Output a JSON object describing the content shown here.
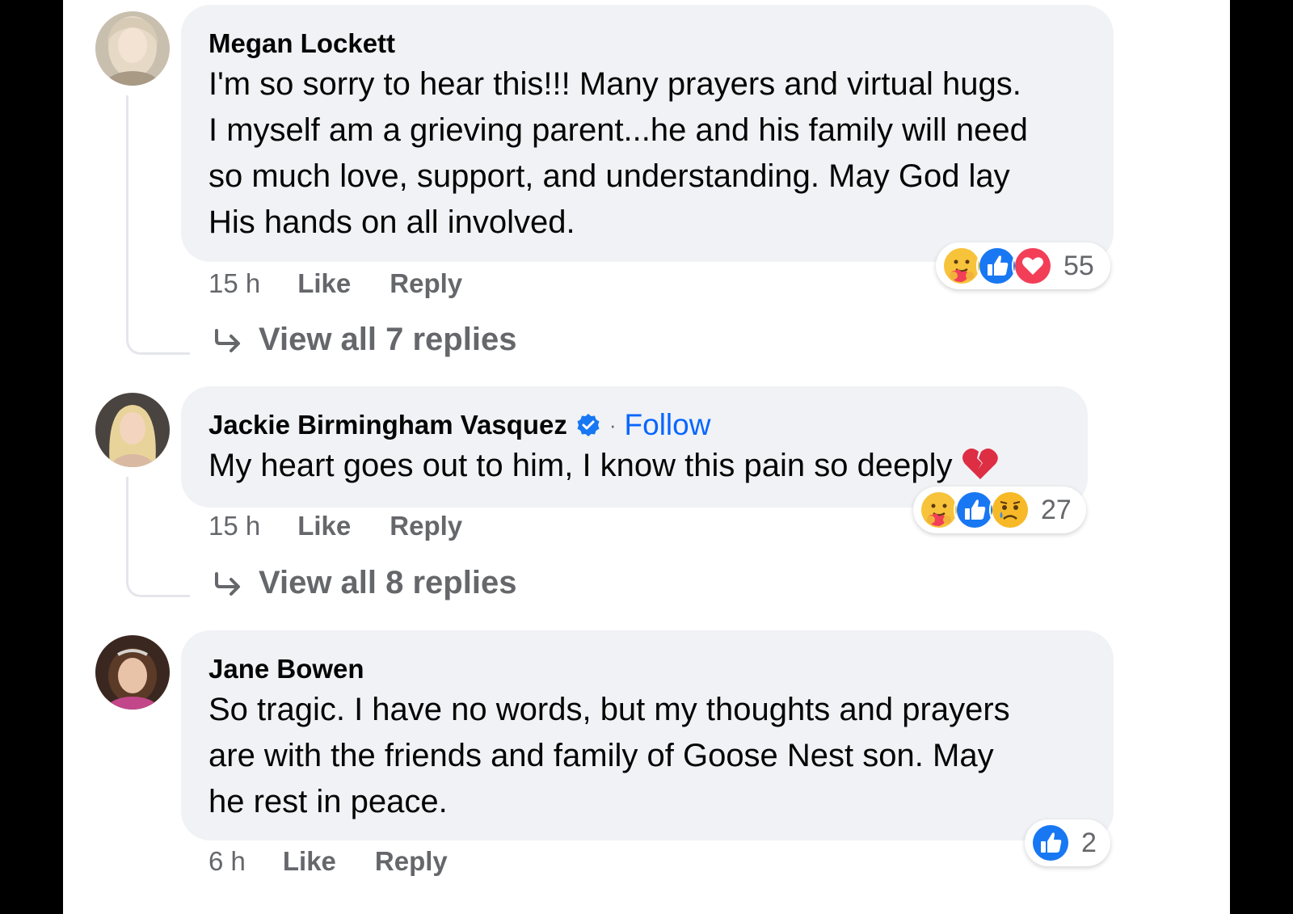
{
  "colors": {
    "bubble_bg": "#f0f2f5",
    "link_blue": "#0866ff",
    "muted_text": "#65676b",
    "like_blue": "#1877f2",
    "love_red": "#f33e58"
  },
  "comments": [
    {
      "author": "Megan Lockett",
      "verified": false,
      "text": "I'm so sorry to hear this!!! Many prayers and virtual hugs.\nI myself am a grieving parent...he and his family will need\nso much love, support, and understanding. May God lay\nHis hands on all involved.",
      "time": "15 h",
      "like_label": "Like",
      "reply_label": "Reply",
      "reactions": [
        "care-icon",
        "like-icon",
        "love-icon"
      ],
      "reaction_count": "55",
      "view_replies": "View all 7 replies"
    },
    {
      "author": "Jackie Birmingham Vasquez",
      "verified": true,
      "follow_separator": "·",
      "follow_label": "Follow",
      "text": "My heart goes out to him, I know this pain so deeply",
      "text_emoji": "broken-heart-icon",
      "time": "15 h",
      "like_label": "Like",
      "reply_label": "Reply",
      "reactions": [
        "care-icon",
        "like-icon",
        "sad-icon"
      ],
      "reaction_count": "27",
      "view_replies": "View all 8 replies"
    },
    {
      "author": "Jane Bowen",
      "verified": false,
      "text": "So tragic. I have no words, but my thoughts and prayers\nare with the friends and family of Goose Nest son. May\nhe rest in peace.",
      "time": "6 h",
      "like_label": "Like",
      "reply_label": "Reply",
      "reactions": [
        "like-icon"
      ],
      "reaction_count": "2"
    }
  ]
}
